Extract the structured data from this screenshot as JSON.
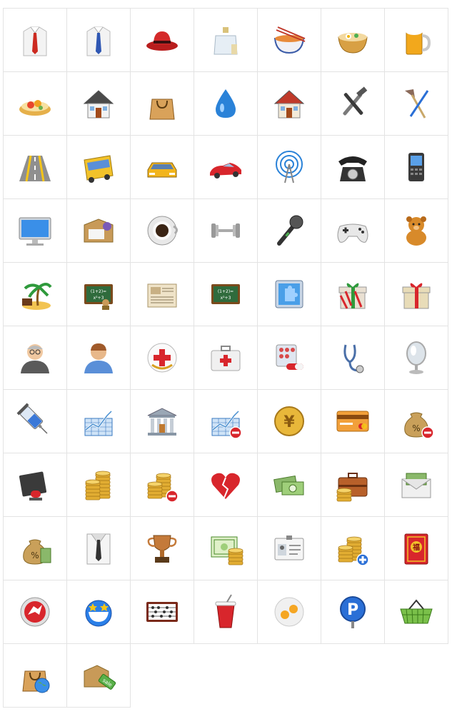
{
  "grid": {
    "columns": 7,
    "icons": [
      "shirt-red-tie-icon",
      "shirt-blue-tie-icon",
      "red-hat-icon",
      "perfume-icon",
      "noodle-bowl-icon",
      "soup-bowl-icon",
      "beer-mug-icon",
      "fruit-tart-icon",
      "house-white-icon",
      "shopping-bag-icon",
      "water-drop-icon",
      "house-red-roof-icon",
      "tools-icon",
      "paint-tools-icon",
      "road-icon",
      "bus-icon",
      "taxi-icon",
      "red-sports-car-icon",
      "antenna-icon",
      "telephone-icon",
      "mobile-phone-icon",
      "monitor-icon",
      "package-box-icon",
      "coffee-cup-icon",
      "dumbbell-icon",
      "microphone-icon",
      "gamepad-icon",
      "teddy-bear-icon",
      "island-icon",
      "chalkboard-teacher-icon",
      "newspaper-icon",
      "chalkboard-icon",
      "puzzle-icon",
      "gift-striped-icon",
      "gift-box-icon",
      "grandpa-avatar-icon",
      "man-avatar-icon",
      "red-cross-badge-icon",
      "first-aid-kit-icon",
      "pills-icon",
      "stethoscope-icon",
      "mirror-icon",
      "syringe-icon",
      "stock-chart-up-icon",
      "bank-icon",
      "stock-chart-minus-icon",
      "yuan-coin-icon",
      "credit-card-icon",
      "money-bag-minus-icon",
      "alarm-book-icon",
      "coin-stack-icon",
      "coin-stack-minus-icon",
      "broken-heart-icon",
      "banknotes-icon",
      "briefcase-coins-icon",
      "envelope-money-icon",
      "money-bag-cash-icon",
      "suit-tie-icon",
      "trophy-icon",
      "certificate-coins-icon",
      "id-card-icon",
      "coin-stack-plus-icon",
      "red-packet-icon",
      "red-logo-badge-icon",
      "smiley-stars-icon",
      "abacus-icon",
      "soda-cup-icon",
      "fried-eggs-icon",
      "parking-sign-icon",
      "shopping-basket-icon",
      "bag-globe-icon",
      "sale-box-icon"
    ]
  }
}
